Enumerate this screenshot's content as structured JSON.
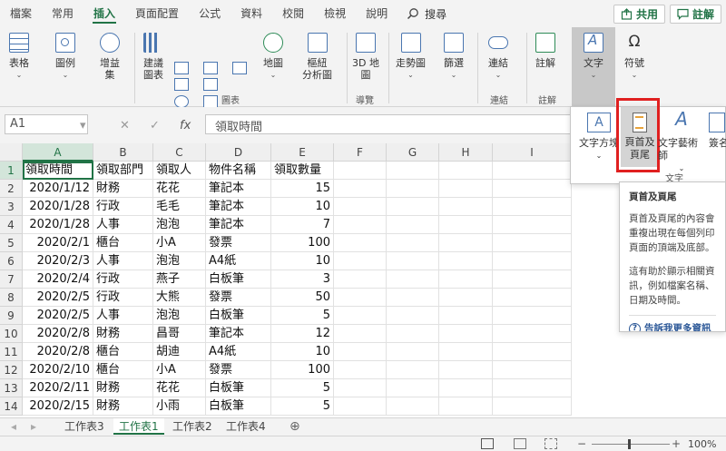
{
  "menu": {
    "tabs": [
      "檔案",
      "常用",
      "插入",
      "頁面配置",
      "公式",
      "資料",
      "校閱",
      "檢視",
      "說明"
    ],
    "active_tab": "插入",
    "search_label": "搜尋",
    "share_label": "共用",
    "comments_label": "註解"
  },
  "ribbon": {
    "table": "表格",
    "illustrations": "圖例",
    "addins_1": "增益",
    "addins_2": "集",
    "recommended_charts_1": "建議",
    "recommended_charts_2": "圖表",
    "maps": "地圖",
    "pivot_chart_1": "樞紐",
    "pivot_chart_2": "分析圖",
    "map3d_1": "3D 地",
    "map3d_2": "圖",
    "sparklines": "走勢圖",
    "filters": "篩選",
    "links": "連結",
    "comment": "註解",
    "text": "文字",
    "symbols": "符號",
    "group_charts": "圖表",
    "group_tours": "導覽",
    "group_links": "連結",
    "group_comments": "註解"
  },
  "formula_bar": {
    "name_box": "A1",
    "content": "領取時間"
  },
  "columns": [
    "A",
    "B",
    "C",
    "D",
    "E",
    "F",
    "G",
    "H",
    "I"
  ],
  "rows": [
    {
      "n": "1",
      "a": "領取時間",
      "b": "領取部門",
      "c": "領取人",
      "d": "物件名稱",
      "e": "領取數量"
    },
    {
      "n": "2",
      "a": "2020/1/12",
      "b": "財務",
      "c": "花花",
      "d": "筆記本",
      "e": "15"
    },
    {
      "n": "3",
      "a": "2020/1/28",
      "b": "行政",
      "c": "毛毛",
      "d": "筆記本",
      "e": "10"
    },
    {
      "n": "4",
      "a": "2020/1/28",
      "b": "人事",
      "c": "泡泡",
      "d": "筆記本",
      "e": "7"
    },
    {
      "n": "5",
      "a": "2020/2/1",
      "b": "櫃台",
      "c": "小A",
      "d": "發票",
      "e": "100"
    },
    {
      "n": "6",
      "a": "2020/2/3",
      "b": "人事",
      "c": "泡泡",
      "d": "A4紙",
      "e": "10"
    },
    {
      "n": "7",
      "a": "2020/2/4",
      "b": "行政",
      "c": "燕子",
      "d": "白板筆",
      "e": "3"
    },
    {
      "n": "8",
      "a": "2020/2/5",
      "b": "行政",
      "c": "大熊",
      "d": "發票",
      "e": "50"
    },
    {
      "n": "9",
      "a": "2020/2/5",
      "b": "人事",
      "c": "泡泡",
      "d": "白板筆",
      "e": "5"
    },
    {
      "n": "10",
      "a": "2020/2/8",
      "b": "財務",
      "c": "昌哥",
      "d": "筆記本",
      "e": "12"
    },
    {
      "n": "11",
      "a": "2020/2/8",
      "b": "櫃台",
      "c": "胡迪",
      "d": "A4紙",
      "e": "10"
    },
    {
      "n": "12",
      "a": "2020/2/10",
      "b": "櫃台",
      "c": "小A",
      "d": "發票",
      "e": "100"
    },
    {
      "n": "13",
      "a": "2020/2/11",
      "b": "財務",
      "c": "花花",
      "d": "白板筆",
      "e": "5"
    },
    {
      "n": "14",
      "a": "2020/2/15",
      "b": "財務",
      "c": "小雨",
      "d": "白板筆",
      "e": "5"
    }
  ],
  "sheets": [
    "工作表3",
    "工作表1",
    "工作表2",
    "工作表4"
  ],
  "active_sheet": "工作表1",
  "status": {
    "zoom": "100%"
  },
  "text_dropdown": {
    "textbox_label": "文字方塊",
    "header_footer_1": "頁首及",
    "header_footer_2": "頁尾",
    "wordart_label": "文字藝術師",
    "signature_label": "簽名",
    "group_label": "文字"
  },
  "tooltip": {
    "title": "頁首及頁尾",
    "body1": "頁首及頁尾的內容會重複出現在每個列印頁面的頂端及底部。",
    "body2": "這有助於顯示相關資訊，例如檔案名稱、日期及時間。",
    "link": "告訴我更多資訊"
  },
  "colors": {
    "accent": "#217346",
    "highlight": "#e02020"
  }
}
